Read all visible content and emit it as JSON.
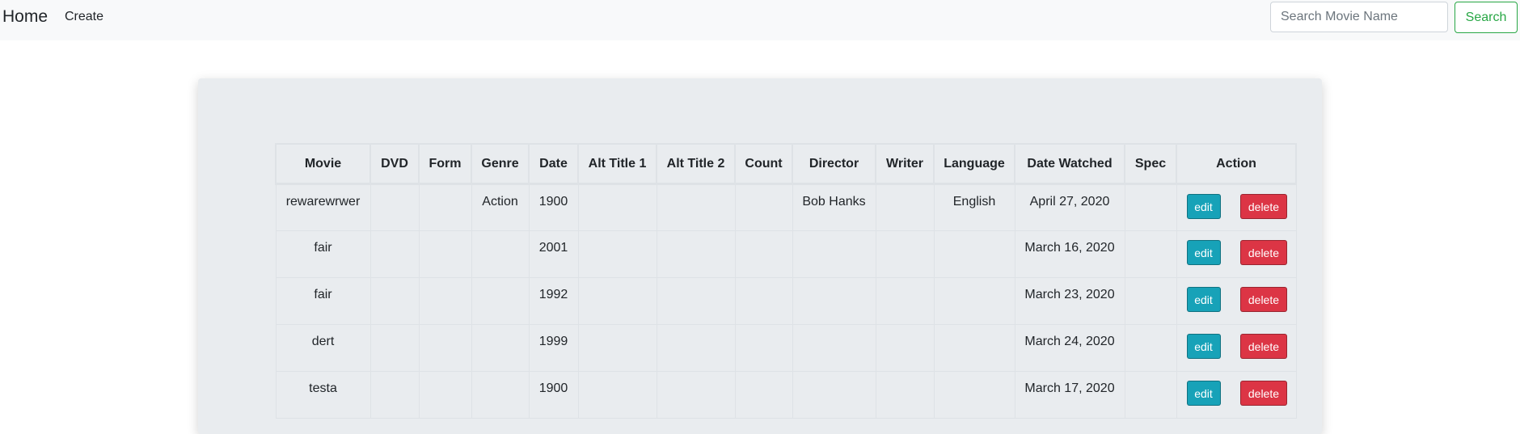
{
  "nav": {
    "brand": "Home",
    "create": "Create"
  },
  "search": {
    "placeholder": "Search Movie Name",
    "value": "",
    "button": "Search"
  },
  "table": {
    "headers": [
      "Movie",
      "DVD",
      "Form",
      "Genre",
      "Date",
      "Alt Title 1",
      "Alt Title 2",
      "Count",
      "Director",
      "Writer",
      "Language",
      "Date Watched",
      "Spec",
      "Action"
    ],
    "rows": [
      {
        "movie": "rewarewrwer",
        "dvd": "",
        "form": "",
        "genre": "Action",
        "date": "1900",
        "alt1": "",
        "alt2": "",
        "count": "",
        "director": "Bob Hanks",
        "writer": "",
        "language": "English",
        "watched": "April 27, 2020",
        "spec": ""
      },
      {
        "movie": "fair",
        "dvd": "",
        "form": "",
        "genre": "",
        "date": "2001",
        "alt1": "",
        "alt2": "",
        "count": "",
        "director": "",
        "writer": "",
        "language": "",
        "watched": "March 16, 2020",
        "spec": ""
      },
      {
        "movie": "fair",
        "dvd": "",
        "form": "",
        "genre": "",
        "date": "1992",
        "alt1": "",
        "alt2": "",
        "count": "",
        "director": "",
        "writer": "",
        "language": "",
        "watched": "March 23, 2020",
        "spec": ""
      },
      {
        "movie": "dert",
        "dvd": "",
        "form": "",
        "genre": "",
        "date": "1999",
        "alt1": "",
        "alt2": "",
        "count": "",
        "director": "",
        "writer": "",
        "language": "",
        "watched": "March 24, 2020",
        "spec": ""
      },
      {
        "movie": "testa",
        "dvd": "",
        "form": "",
        "genre": "",
        "date": "1900",
        "alt1": "",
        "alt2": "",
        "count": "",
        "director": "",
        "writer": "",
        "language": "",
        "watched": "March 17, 2020",
        "spec": ""
      }
    ]
  },
  "actions": {
    "edit": "edit",
    "delete": "delete"
  },
  "colors": {
    "edit": "#17a2b8",
    "delete": "#dc3545",
    "search": "#28a745",
    "panel": "#e9ecef"
  }
}
